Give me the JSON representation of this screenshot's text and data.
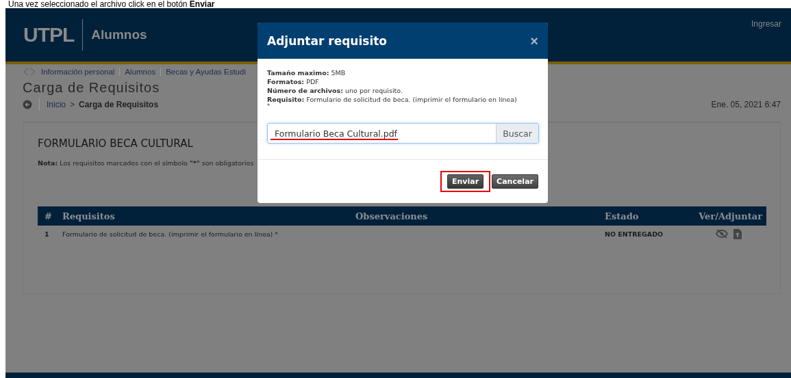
{
  "caption": "Una vez seleccionado el archivo click en el botón **Enviar**",
  "header": {
    "logo": "UTPL",
    "section": "Alumnos",
    "login_link": "Ingresar"
  },
  "breadcrumb_menu": [
    "Información personal",
    "Alumnos",
    "Becas y Ayudas Estudi"
  ],
  "page_title": "Carga de Requisitos",
  "breadcrumb": {
    "home": "Inicio",
    "separator": ">",
    "current": "Carga de Requisitos"
  },
  "date": "Ene. 05, 2021 6:47",
  "form": {
    "title": "FORMULARIO BECA CULTURAL",
    "note": "**Nota:** Los requisitos marcados con el símbolo **\"*\"** son obligatorios",
    "table": {
      "columns": [
        "#",
        "Requisitos",
        "Observaciones",
        "Estado",
        "Ver/Adjuntar"
      ],
      "rows": [
        {
          "number": "1",
          "requirement": "Formulario de solicitud de beca. (imprimir el formulario en línea) *",
          "status": "NO ENTREGADO"
        }
      ]
    }
  },
  "modal": {
    "title": "Adjuntar requisito",
    "close": "×",
    "info": [
      "**Tamaño maximo:** 5MB",
      "**Formatos:** PDF",
      "**Número de archivos:** uno por requisito.",
      "**Requisito:** Formulario de solicitud de beca. (imprimir el formulario en línea)"
    ],
    "info_mark": "*",
    "file_value": "Formulario Beca Cultural.pdf",
    "browse": "Buscar",
    "buttons": [
      {
        "label": "Enviar",
        "kind": "primary",
        "highlighted": true
      },
      {
        "label": "Cancelar",
        "kind": "secondary",
        "highlighted": false
      }
    ]
  }
}
